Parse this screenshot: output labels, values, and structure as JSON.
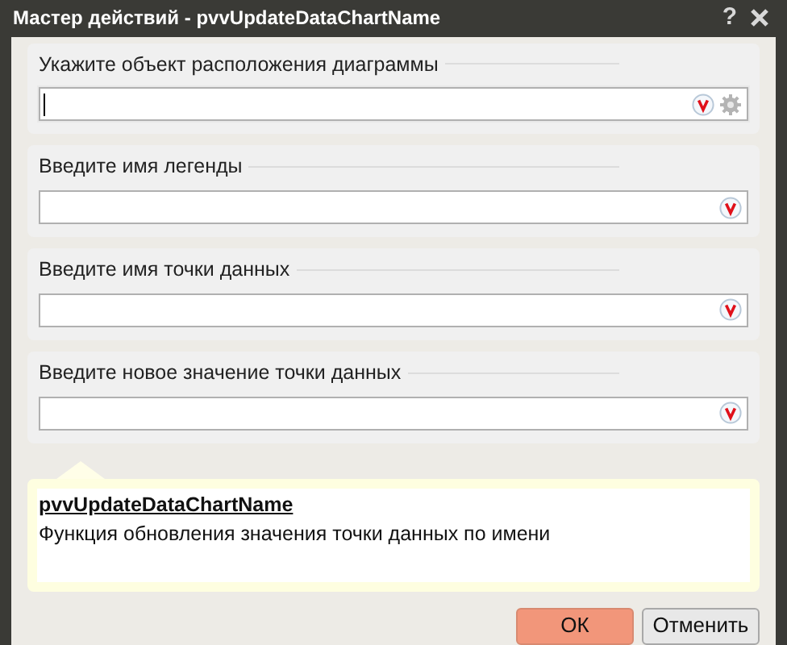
{
  "window": {
    "title": "Мастер действий - pvvUpdateDataChartName",
    "help": "?"
  },
  "fields": [
    {
      "label": "Укажите объект расположения диаграммы",
      "focused": true,
      "settings": true
    },
    {
      "label": "Введите имя легенды",
      "focused": false,
      "settings": false
    },
    {
      "label": "Введите имя точки данных",
      "focused": false,
      "settings": false
    },
    {
      "label": "Введите новое значение точки данных",
      "focused": false,
      "settings": false
    }
  ],
  "info": {
    "title": "pvvUpdateDataChartName",
    "description": "Функция обновления значения точки данных по имени"
  },
  "buttons": [
    {
      "label": "ОК",
      "primary": true
    },
    {
      "label": "Отменить",
      "primary": false
    }
  ]
}
